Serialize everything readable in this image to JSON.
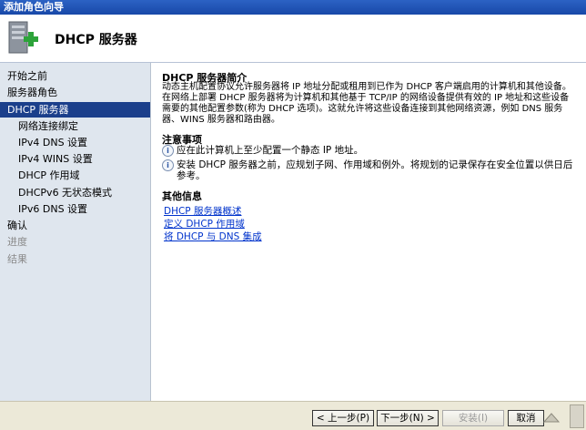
{
  "window": {
    "title": "添加角色向导"
  },
  "header": {
    "title": "DHCP 服务器"
  },
  "sidebar": {
    "items": [
      {
        "label": "开始之前",
        "state": "normal"
      },
      {
        "label": "服务器角色",
        "state": "normal"
      },
      {
        "label": "DHCP 服务器",
        "state": "active"
      },
      {
        "label": "网络连接绑定",
        "state": "sub"
      },
      {
        "label": "IPv4 DNS 设置",
        "state": "sub"
      },
      {
        "label": "IPv4 WINS 设置",
        "state": "sub"
      },
      {
        "label": "DHCP 作用域",
        "state": "sub"
      },
      {
        "label": "DHCPv6 无状态模式",
        "state": "sub"
      },
      {
        "label": "IPv6 DNS 设置",
        "state": "sub"
      },
      {
        "label": "确认",
        "state": "normal"
      },
      {
        "label": "进度",
        "state": "disabled"
      },
      {
        "label": "结果",
        "state": "disabled"
      }
    ]
  },
  "main": {
    "intro": {
      "title": "DHCP 服务器简介",
      "text": "动态主机配置协议允许服务器将 IP 地址分配或租用到已作为 DHCP 客户端启用的计算机和其他设备。在网络上部署 DHCP 服务器将为计算机和其他基于 TCP/IP 的网络设备提供有效的 IP 地址和这些设备需要的其他配置参数(称为 DHCP 选项)。这就允许将这些设备连接到其他网络资源，例如 DNS 服务器、WINS 服务器和路由器。"
    },
    "notes": {
      "title": "注意事项",
      "items": [
        "应在此计算机上至少配置一个静态 IP 地址。",
        "安装 DHCP 服务器之前，应规划子网、作用域和例外。将规划的记录保存在安全位置以供日后参考。"
      ]
    },
    "info": {
      "title": "其他信息",
      "links": [
        "DHCP 服务器概述",
        "定义 DHCP 作用域",
        "将 DHCP 与 DNS 集成"
      ]
    }
  },
  "footer": {
    "prev_label": "< 上一步(P)",
    "next_label": "下一步(N) >",
    "install_label": "安装(I)",
    "cancel_label": "取消"
  },
  "colors": {
    "title_bar": "#1848a8",
    "active_nav": "#1b3f8b",
    "sidebar_bg": "#dfe6ee",
    "link": "#0033cc"
  }
}
